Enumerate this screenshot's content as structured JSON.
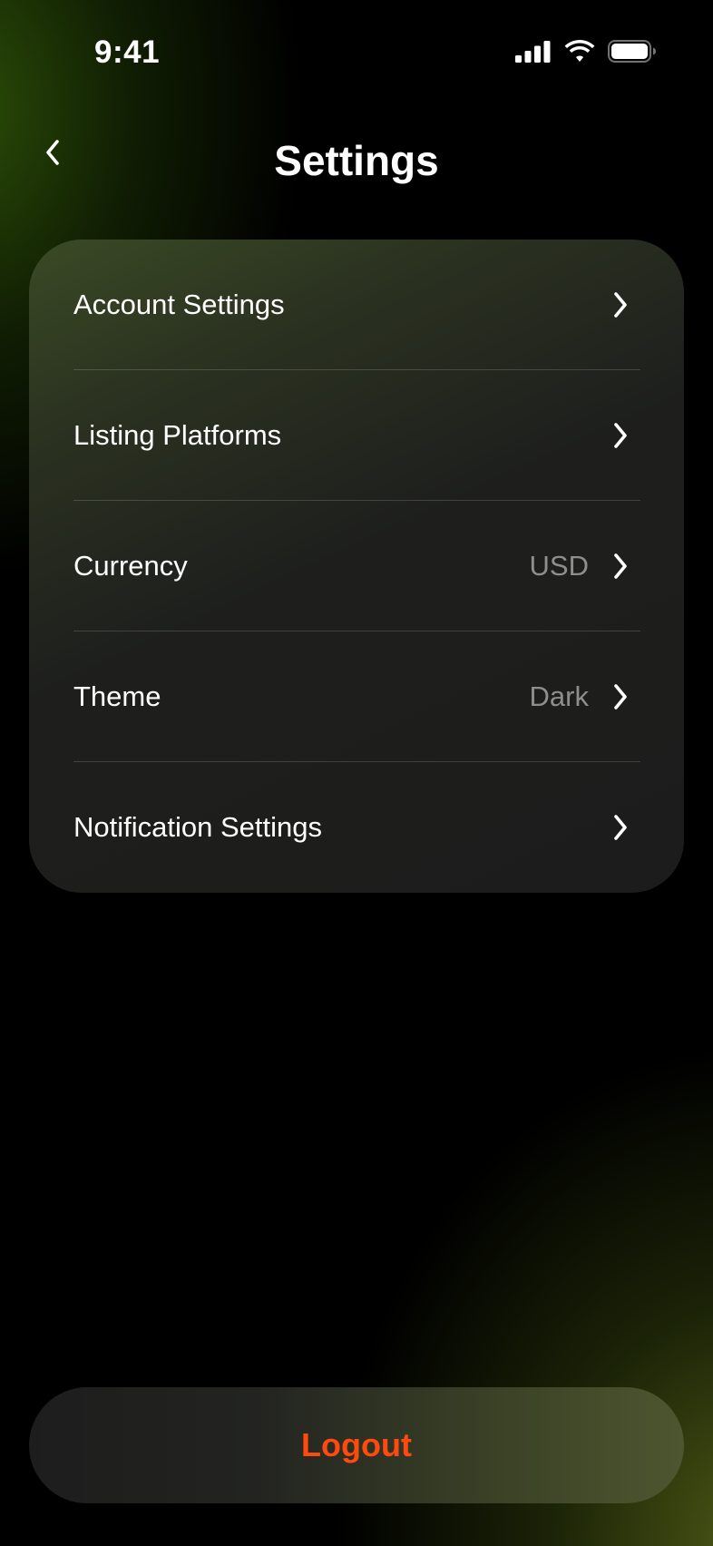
{
  "status_bar": {
    "time": "9:41"
  },
  "nav": {
    "title": "Settings",
    "back_icon": "chevron-left-icon"
  },
  "settings": {
    "items": [
      {
        "label": "Account Settings",
        "value": ""
      },
      {
        "label": "Listing Platforms",
        "value": ""
      },
      {
        "label": "Currency",
        "value": "USD"
      },
      {
        "label": "Theme",
        "value": "Dark"
      },
      {
        "label": "Notification Settings",
        "value": ""
      }
    ]
  },
  "logout": {
    "label": "Logout",
    "color": "#ff4a0f"
  },
  "colors": {
    "background": "#000000",
    "card": "#1c1c1c",
    "accent_green": "#2e5208",
    "secondary_text": "#8e8e8e"
  }
}
